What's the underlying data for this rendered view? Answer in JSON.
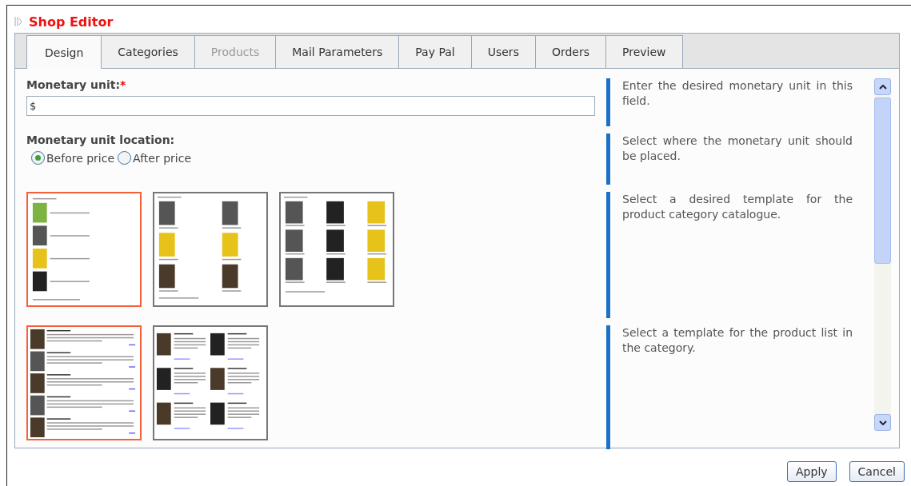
{
  "window": {
    "title": "Shop Editor"
  },
  "tabs": [
    {
      "label": "Design",
      "selected": true,
      "disabled": false
    },
    {
      "label": "Categories",
      "selected": false,
      "disabled": false
    },
    {
      "label": "Products",
      "selected": false,
      "disabled": true
    },
    {
      "label": "Mail Parameters",
      "selected": false,
      "disabled": false
    },
    {
      "label": "Pay Pal",
      "selected": false,
      "disabled": false
    },
    {
      "label": "Users",
      "selected": false,
      "disabled": false
    },
    {
      "label": "Orders",
      "selected": false,
      "disabled": false
    },
    {
      "label": "Preview",
      "selected": false,
      "disabled": false
    }
  ],
  "sections": [
    {
      "kind": "text",
      "label": "Monetary unit:",
      "required_mark": "*",
      "value": "$",
      "hint": "Enter the desired monetary unit in this field."
    },
    {
      "kind": "radio",
      "label": "Monetary unit location:",
      "options": [
        {
          "label": "Before price",
          "selected": true
        },
        {
          "label": "After price",
          "selected": false
        }
      ],
      "hint": "Select where the monetary unit should be placed."
    },
    {
      "kind": "templates",
      "templates": [
        {
          "kind": "icon-list",
          "selected": true
        },
        {
          "kind": "grid-2",
          "selected": false
        },
        {
          "kind": "grid-3",
          "selected": false
        }
      ],
      "hint": "Select a desired template for the product category catalogue."
    },
    {
      "kind": "templates",
      "templates": [
        {
          "kind": "row-list",
          "selected": true
        },
        {
          "kind": "two-column",
          "selected": false
        }
      ],
      "hint": "Select a template for the product list in the category."
    }
  ],
  "buttons": [
    {
      "label": "Apply"
    },
    {
      "label": "Cancel"
    }
  ]
}
